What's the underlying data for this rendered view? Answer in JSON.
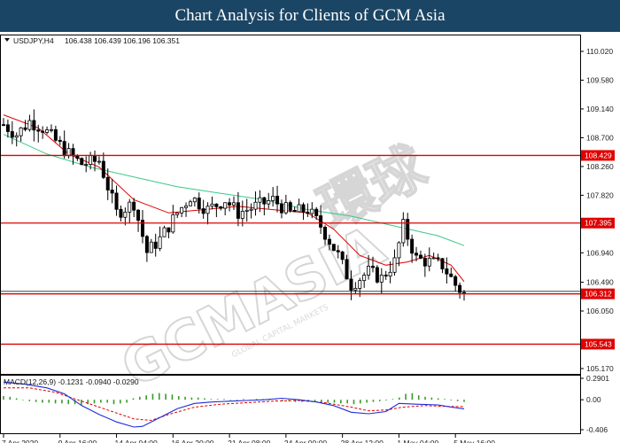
{
  "page_title": "Chart Analysis for Clients of GCM Asia",
  "price_header": {
    "symbol": "USDJPY,H4",
    "values": "106.438 106.439 106.196 106.351"
  },
  "macd_header": "MACD(12,26,9) -0.1231 -0.0940 -0.0290",
  "watermark": {
    "main": "GCMASIA",
    "chinese": "環球",
    "sub": "GLOBAL CAPITAL MARKETS"
  },
  "chart_data": [
    {
      "type": "candlestick",
      "symbol": "USDJPY",
      "timeframe": "H4",
      "y_ticks": [
        "110.020",
        "109.580",
        "109.140",
        "108.700",
        "108.260",
        "107.820",
        "107.395",
        "106.940",
        "106.490",
        "106.050",
        "105.170"
      ],
      "ylim": [
        105.17,
        110.24
      ],
      "x_ticks": [
        "7 Apr 2020",
        "9 Apr 16:00",
        "14 Apr 04:00",
        "16 Apr 20:00",
        "21 Apr 08:00",
        "24 Apr 00:00",
        "28 Apr 12:00",
        "1 May 04:00",
        "5 May 16:00"
      ],
      "horizontal_levels": [
        {
          "value": 108.429,
          "label": "108.429",
          "color": "#e00000"
        },
        {
          "value": 107.395,
          "label": "107.395",
          "color": "#e00000"
        },
        {
          "value": 106.312,
          "label": "106.312",
          "color": "#e00000"
        },
        {
          "value": 105.543,
          "label": "105.543",
          "color": "#e00000"
        }
      ],
      "last_price_marker": {
        "value": 106.35
      },
      "candle_close_path": [
        [
          0,
          108.9
        ],
        [
          3,
          108.75
        ],
        [
          6,
          108.95
        ],
        [
          9,
          108.85
        ],
        [
          12,
          108.65
        ],
        [
          15,
          108.45
        ],
        [
          18,
          108.3
        ],
        [
          22,
          108.35
        ],
        [
          26,
          107.55
        ],
        [
          30,
          107.7
        ],
        [
          33,
          106.95
        ],
        [
          36,
          107.15
        ],
        [
          40,
          107.55
        ],
        [
          43,
          107.8
        ],
        [
          47,
          107.6
        ],
        [
          51,
          107.75
        ],
        [
          54,
          107.55
        ],
        [
          58,
          107.65
        ],
        [
          62,
          107.75
        ],
        [
          66,
          107.55
        ],
        [
          70,
          107.6
        ],
        [
          73,
          107.35
        ],
        [
          77,
          106.9
        ],
        [
          80,
          106.45
        ],
        [
          84,
          106.65
        ],
        [
          87,
          106.55
        ],
        [
          90,
          106.8
        ],
        [
          92,
          107.35
        ],
        [
          95,
          106.85
        ],
        [
          98,
          106.8
        ],
        [
          101,
          106.75
        ],
        [
          104,
          106.45
        ],
        [
          106,
          106.3
        ]
      ],
      "ma_fast": {
        "color": "#e00000",
        "points": [
          [
            0,
            109.05
          ],
          [
            8,
            108.85
          ],
          [
            15,
            108.45
          ],
          [
            22,
            108.25
          ],
          [
            30,
            107.75
          ],
          [
            38,
            107.55
          ],
          [
            46,
            107.6
          ],
          [
            54,
            107.65
          ],
          [
            62,
            107.6
          ],
          [
            70,
            107.55
          ],
          [
            76,
            107.3
          ],
          [
            82,
            106.9
          ],
          [
            88,
            106.75
          ],
          [
            93,
            106.8
          ],
          [
            98,
            106.9
          ],
          [
            103,
            106.75
          ],
          [
            106,
            106.5
          ]
        ]
      },
      "ma_slow": {
        "color": "#3cc88c",
        "points": [
          [
            0,
            108.75
          ],
          [
            10,
            108.45
          ],
          [
            20,
            108.25
          ],
          [
            30,
            108.1
          ],
          [
            40,
            107.95
          ],
          [
            50,
            107.85
          ],
          [
            60,
            107.75
          ],
          [
            70,
            107.6
          ],
          [
            80,
            107.5
          ],
          [
            90,
            107.35
          ],
          [
            100,
            107.2
          ],
          [
            106,
            107.05
          ]
        ]
      }
    },
    {
      "type": "macd",
      "params": "12,26,9",
      "values": {
        "macd": -0.1231,
        "signal": -0.094,
        "histogram": -0.029
      },
      "y_ticks": [
        "0.2901",
        "0.00",
        "-0.406"
      ],
      "ylim": [
        -0.406,
        0.2901
      ],
      "histogram": [
        0.05,
        0.04,
        0.02,
        0.0,
        -0.02,
        -0.03,
        -0.04,
        -0.04,
        -0.05,
        -0.05,
        -0.06,
        -0.06,
        -0.07,
        -0.06,
        -0.05,
        -0.04,
        -0.04,
        -0.06,
        -0.05,
        -0.04,
        0.02,
        0.04,
        0.06,
        0.08,
        0.09,
        0.08,
        0.07,
        0.05,
        0.04,
        0.03,
        0.03,
        0.02,
        0.01,
        0.01,
        0.01,
        0.0,
        0.0,
        0.01,
        0.0,
        0.01,
        0.01,
        0.0,
        0.0,
        -0.02,
        -0.02,
        -0.03,
        -0.03,
        -0.02,
        -0.03,
        -0.03,
        -0.04,
        -0.04,
        -0.05,
        -0.05,
        -0.06,
        -0.05,
        -0.04,
        -0.03,
        -0.02,
        -0.01,
        0.01,
        0.03,
        0.08,
        0.09,
        0.06,
        0.04,
        0.03,
        0.02,
        0.01,
        -0.01,
        -0.02,
        -0.03
      ],
      "macd_line": {
        "color": "#1e2bd8",
        "points": [
          [
            0,
            0.24
          ],
          [
            5,
            0.21
          ],
          [
            10,
            0.16
          ],
          [
            14,
            0.08
          ],
          [
            18,
            -0.08
          ],
          [
            22,
            -0.2
          ],
          [
            26,
            -0.3
          ],
          [
            30,
            -0.37
          ],
          [
            32,
            -0.36
          ],
          [
            36,
            -0.24
          ],
          [
            40,
            -0.12
          ],
          [
            44,
            -0.05
          ],
          [
            48,
            -0.03
          ],
          [
            52,
            -0.02
          ],
          [
            56,
            -0.01
          ],
          [
            60,
            0.0
          ],
          [
            64,
            0.02
          ],
          [
            68,
            0.0
          ],
          [
            72,
            -0.03
          ],
          [
            76,
            -0.08
          ],
          [
            80,
            -0.17
          ],
          [
            84,
            -0.19
          ],
          [
            88,
            -0.16
          ],
          [
            91,
            -0.05
          ],
          [
            95,
            -0.06
          ],
          [
            100,
            -0.07
          ],
          [
            103,
            -0.1
          ],
          [
            106,
            -0.123
          ]
        ]
      },
      "signal_line": {
        "color": "#e00000",
        "points": [
          [
            0,
            0.16
          ],
          [
            6,
            0.16
          ],
          [
            12,
            0.1
          ],
          [
            18,
            -0.02
          ],
          [
            24,
            -0.14
          ],
          [
            30,
            -0.26
          ],
          [
            34,
            -0.28
          ],
          [
            38,
            -0.2
          ],
          [
            44,
            -0.1
          ],
          [
            50,
            -0.06
          ],
          [
            56,
            -0.04
          ],
          [
            62,
            -0.02
          ],
          [
            68,
            -0.01
          ],
          [
            74,
            -0.04
          ],
          [
            80,
            -0.1
          ],
          [
            84,
            -0.15
          ],
          [
            88,
            -0.14
          ],
          [
            92,
            -0.1
          ],
          [
            97,
            -0.08
          ],
          [
            102,
            -0.09
          ],
          [
            106,
            -0.094
          ]
        ]
      }
    }
  ],
  "colors": {
    "title_bar": "#1b4564",
    "level_line": "#e00000",
    "grid": "#000000"
  }
}
